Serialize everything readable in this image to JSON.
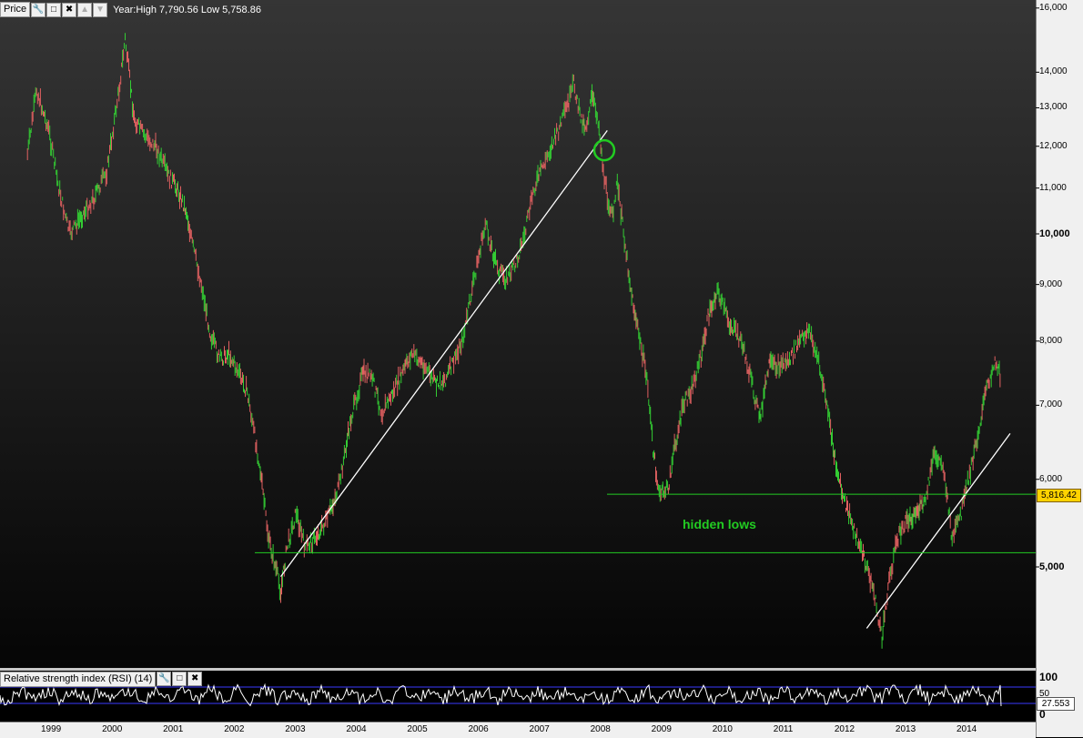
{
  "window": {
    "pane_title": "Price",
    "info_text": "Year:High 7,790.56 Low 5,758.86",
    "rsi_title": "Relative strength index (RSI) (14)"
  },
  "toolbar_icons": [
    "wrench-icon",
    "maximize-icon",
    "close-icon",
    "move-up-icon",
    "move-down-icon"
  ],
  "rsi_toolbar_icons": [
    "wrench-icon",
    "maximize-icon",
    "close-icon"
  ],
  "price_axis": {
    "ticks": [
      "16,000",
      "14,000",
      "13,000",
      "12,000",
      "11,000",
      "10,000",
      "9,000",
      "8,000",
      "7,000",
      "6,000",
      "5,000"
    ],
    "ticks_numeric": [
      16000,
      14000,
      13000,
      12000,
      11000,
      10000,
      9000,
      8000,
      7000,
      6000,
      5000
    ],
    "scale": "log",
    "current_price": "5,816.42",
    "current_price_color": "#ffd200"
  },
  "rsi_axis": {
    "ticks": [
      "100",
      "50",
      "0"
    ],
    "current_value": "27.553",
    "upper_level": 70,
    "lower_level": 30
  },
  "date_axis": {
    "years": [
      "1999",
      "2000",
      "2001",
      "2002",
      "2003",
      "2004",
      "2005",
      "2006",
      "2007",
      "2008",
      "2009",
      "2010",
      "2011",
      "2012",
      "2013",
      "2014"
    ]
  },
  "annotations": {
    "hidden_lows_label": "hidden lows",
    "annotation_color": "#22cc22",
    "trendline_color": "#ffffff",
    "up_bar_color": "#33cc33",
    "down_bar_color": "#e06060"
  },
  "chart_data": {
    "type": "line",
    "yscale": "log",
    "ylim": [
      4200,
      16000
    ],
    "x": [
      1998.6,
      1998.75,
      1998.95,
      1999.1,
      1999.25,
      1999.3,
      1999.5,
      1999.7,
      1999.9,
      2000.1,
      2000.2,
      2000.35,
      2000.5,
      2000.7,
      2000.9,
      2001.05,
      2001.2,
      2001.3,
      2001.45,
      2001.6,
      2001.75,
      2001.9,
      2002.0,
      2002.2,
      2002.4,
      2002.55,
      2002.7,
      2002.75,
      2002.85,
      2003.0,
      2003.15,
      2003.3,
      2003.5,
      2003.7,
      2003.9,
      2004.1,
      2004.25,
      2004.4,
      2004.6,
      2004.8,
      2004.9,
      2005.1,
      2005.3,
      2005.45,
      2005.6,
      2005.75,
      2005.9,
      2006.1,
      2006.3,
      2006.45,
      2006.6,
      2006.75,
      2006.9,
      2007.1,
      2007.3,
      2007.5,
      2007.55,
      2007.65,
      2007.75,
      2007.85,
      2007.95,
      2008.05,
      2008.1,
      2008.2,
      2008.25,
      2008.35,
      2008.5,
      2008.6,
      2008.75,
      2008.85,
      2008.95,
      2009.1,
      2009.2,
      2009.35,
      2009.5,
      2009.65,
      2009.75,
      2009.9,
      2010.1,
      2010.3,
      2010.45,
      2010.6,
      2010.75,
      2010.9,
      2011.1,
      2011.25,
      2011.4,
      2011.55,
      2011.7,
      2011.8,
      2011.95,
      2012.1,
      2012.25,
      2012.35,
      2012.45,
      2012.6,
      2012.7,
      2012.85,
      2013.0,
      2013.15,
      2013.3,
      2013.45,
      2013.6,
      2013.75,
      2013.9,
      2014.05,
      2014.15,
      2014.3,
      2014.45,
      2014.55
    ],
    "y": [
      11800,
      13500,
      12400,
      11100,
      10200,
      10000,
      10400,
      10800,
      11400,
      13500,
      15000,
      12700,
      12300,
      12000,
      11300,
      11000,
      10500,
      9800,
      9000,
      8100,
      7700,
      7800,
      7600,
      7200,
      6200,
      5300,
      4900,
      4750,
      5200,
      5600,
      5200,
      5300,
      5500,
      5900,
      6800,
      7500,
      7400,
      6900,
      7200,
      7600,
      7800,
      7600,
      7300,
      7400,
      7700,
      8100,
      9000,
      10200,
      9300,
      9100,
      9400,
      10000,
      11000,
      11700,
      12400,
      13300,
      13700,
      12800,
      12500,
      13300,
      12700,
      11200,
      10800,
      10300,
      11200,
      10200,
      8800,
      8200,
      7400,
      6400,
      5800,
      5900,
      6400,
      7000,
      7300,
      7800,
      8400,
      8900,
      8300,
      8000,
      7400,
      6800,
      7600,
      7600,
      7700,
      8000,
      8200,
      7700,
      7000,
      6400,
      5800,
      5500,
      5200,
      5000,
      4800,
      4300,
      4800,
      5300,
      5500,
      5600,
      5700,
      6300,
      6200,
      5300,
      5600,
      6100,
      6500,
      7200,
      7700,
      7400,
      6500,
      5800
    ],
    "trendlines": [
      {
        "x": [
          2002.75,
          2008.1
        ],
        "y": [
          4900,
          12400
        ]
      },
      {
        "x": [
          2012.35,
          2014.7
        ],
        "y": [
          4400,
          6600
        ]
      }
    ],
    "horizontal_levels": [
      5816.42,
      5150
    ],
    "highlight_circle": {
      "x": 2008.05,
      "y": 11900
    }
  }
}
